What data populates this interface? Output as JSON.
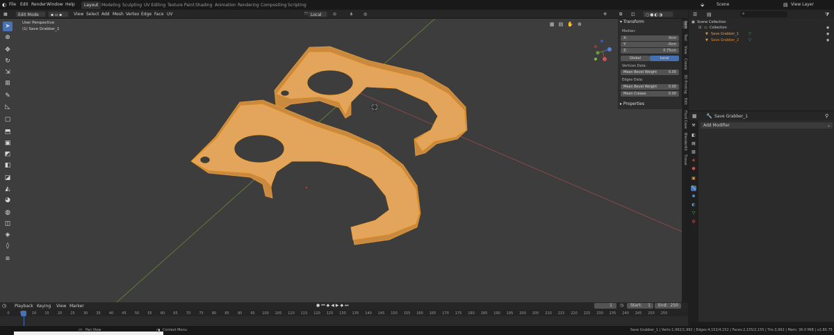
{
  "topbar": {
    "menus": [
      "File",
      "Edit",
      "Render",
      "Window",
      "Help"
    ],
    "workspaces": [
      "Layout",
      "Modeling",
      "Sculpting",
      "UV Editing",
      "Texture Paint",
      "Shading",
      "Animation",
      "Rendering",
      "Compositing",
      "Scripting"
    ],
    "active_workspace": "Layout",
    "scene_label": "Scene",
    "view_layer_label": "View Layer"
  },
  "viewport_header": {
    "mode": "Edit Mode",
    "menus": [
      "View",
      "Select",
      "Add",
      "Mesh",
      "Vertex",
      "Edge",
      "Face",
      "UV"
    ],
    "orientation": "Local"
  },
  "viewport": {
    "perspective_label": "User Perspective",
    "object_label": "(1) Save Grabber_1"
  },
  "npanel": {
    "transform_title": "Transform",
    "median_label": "Median:",
    "fields": [
      {
        "label": "X:",
        "value": "0cm"
      },
      {
        "label": "Y:",
        "value": "-0cm"
      },
      {
        "label": "Z:",
        "value": "0.75cm"
      }
    ],
    "global_label": "Global",
    "local_label": "Local",
    "vertices_data_label": "Vertices Data:",
    "mean_bevel_weight_v": {
      "label": "Mean Bevel Weight",
      "value": "0.00"
    },
    "edges_data_label": "Edges Data:",
    "mean_bevel_weight_e": {
      "label": "Mean Bevel Weight",
      "value": "0.00"
    },
    "mean_crease": {
      "label": "Mean Crease",
      "value": "0.00"
    },
    "properties_title": "Properties",
    "side_tabs": [
      "Item",
      "Tool",
      "View",
      "Create",
      "3D Printing",
      "Edit",
      "Fluid Cave",
      "BlenderKit",
      "Tissue"
    ]
  },
  "outliner": {
    "scene_collection": "Scene Collection",
    "collection": "Collection",
    "objects": [
      "Save Grabber_1",
      "Save Grabber_2"
    ]
  },
  "properties": {
    "object_name": "Save Grabber_1",
    "add_modifier": "Add Modifier"
  },
  "timeline": {
    "menus": [
      "Playback",
      "Keying",
      "View",
      "Marker"
    ],
    "current_frame": "1",
    "start_label": "Start:",
    "start_value": "1",
    "end_label": "End:",
    "end_value": "250",
    "ticks": [
      "0",
      "5",
      "10",
      "15",
      "20",
      "25",
      "30",
      "35",
      "40",
      "45",
      "50",
      "55",
      "60",
      "65",
      "70",
      "75",
      "80",
      "85",
      "90",
      "95",
      "100",
      "105",
      "110",
      "115",
      "120",
      "125",
      "130",
      "135",
      "140",
      "145",
      "150",
      "155",
      "160",
      "165",
      "170",
      "175",
      "180",
      "185",
      "190",
      "195",
      "200",
      "205",
      "210",
      "215",
      "220",
      "225",
      "230",
      "235",
      "240",
      "245",
      "250",
      "255"
    ]
  },
  "statusbar": {
    "pan_view": "Pan View",
    "context_menu": "Context Menu",
    "stats": "Save Grabber_1 | Verts:1,992/1,992 | Edges:4,152/4,152 | Faces:2,155/2,155 | Tris:3,992 | Mem: 36.0 MiB | v2.80.75"
  },
  "colors": {
    "accent": "#4772b3",
    "mesh": "#d89a4c",
    "mesh_edge": "#f0a030",
    "x_axis": "#9a4b52",
    "y_axis": "#6f8a3a",
    "viewport_bg": "#3d3d3d"
  }
}
